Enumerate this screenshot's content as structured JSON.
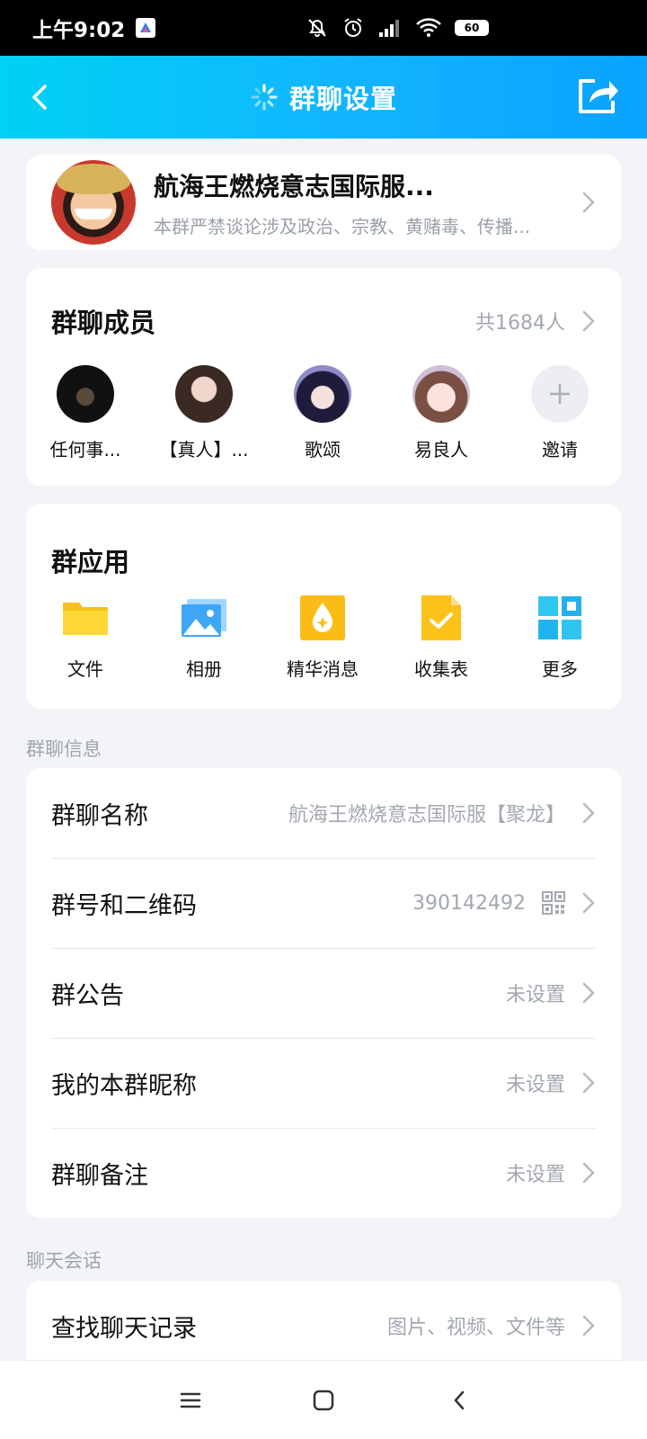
{
  "status_bar": {
    "time": "上午9:02",
    "battery": "60"
  },
  "header": {
    "title": "群聊设置"
  },
  "group": {
    "name": "航海王燃烧意志国际服...",
    "description": "本群严禁谈论涉及政治、宗教、黄赌毒、传播..."
  },
  "members": {
    "title": "群聊成员",
    "count": "共1684人",
    "list": [
      {
        "name": "任何事..."
      },
      {
        "name": "【真人】..."
      },
      {
        "name": "歌颂"
      },
      {
        "name": "易良人"
      },
      {
        "name": "邀请"
      }
    ]
  },
  "apps": {
    "title": "群应用",
    "items": [
      {
        "label": "文件",
        "icon": "folder-icon"
      },
      {
        "label": "相册",
        "icon": "album-icon"
      },
      {
        "label": "精华消息",
        "icon": "essence-icon"
      },
      {
        "label": "收集表",
        "icon": "form-icon"
      },
      {
        "label": "更多",
        "icon": "grid-icon"
      }
    ]
  },
  "group_info": {
    "section_label": "群聊信息",
    "rows": [
      {
        "label": "群聊名称",
        "value": "航海王燃烧意志国际服【聚龙】"
      },
      {
        "label": "群号和二维码",
        "value": "390142492"
      },
      {
        "label": "群公告",
        "value": "未设置"
      },
      {
        "label": "我的本群昵称",
        "value": "未设置"
      },
      {
        "label": "群聊备注",
        "value": "未设置"
      }
    ]
  },
  "chat": {
    "section_label": "聊天会话",
    "rows": [
      {
        "label": "查找聊天记录",
        "value": "图片、视频、文件等"
      }
    ]
  },
  "colors": {
    "header_gradient_start": "#00d2f4",
    "header_gradient_end": "#0aa2ff",
    "page_background": "#f3f4f8",
    "secondary_text": "#a3a8b0"
  }
}
